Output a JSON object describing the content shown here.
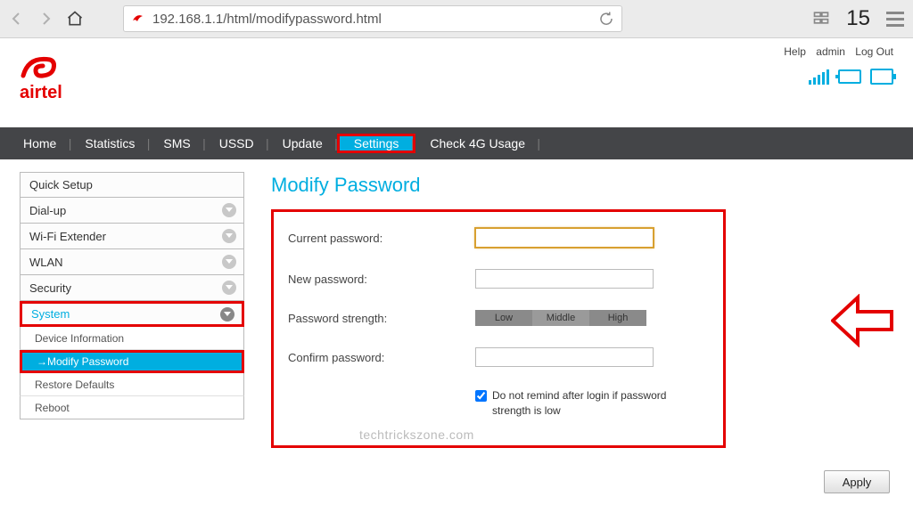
{
  "browser": {
    "url": "192.168.1.1/html/modifypassword.html",
    "tab_count": "15"
  },
  "brand": {
    "name": "airtel",
    "accent": "#e40000",
    "link_accent": "#00aee0"
  },
  "top_links": {
    "help": "Help",
    "admin": "admin",
    "logout": "Log Out"
  },
  "nav": {
    "items": [
      "Home",
      "Statistics",
      "SMS",
      "USSD",
      "Update",
      "Settings",
      "Check 4G Usage"
    ],
    "active_index": 5
  },
  "sidebar": {
    "items": [
      {
        "label": "Quick Setup",
        "arrow": false
      },
      {
        "label": "Dial-up",
        "arrow": true
      },
      {
        "label": "Wi-Fi Extender",
        "arrow": true
      },
      {
        "label": "WLAN",
        "arrow": true
      },
      {
        "label": "Security",
        "arrow": true
      },
      {
        "label": "System",
        "arrow": true
      }
    ],
    "sub_items": [
      "Device Information",
      "→Modify Password",
      "Restore Defaults",
      "Reboot"
    ],
    "active_sub_index": 1
  },
  "page": {
    "title": "Modify Password",
    "current_label": "Current password:",
    "new_label": "New password:",
    "strength_label": "Password strength:",
    "confirm_label": "Confirm password:",
    "strength_levels": [
      "Low",
      "Middle",
      "High"
    ],
    "checkbox_label": "Do not remind after login if password strength is low",
    "checkbox_checked": true,
    "current_value": "",
    "new_value": "",
    "confirm_value": "",
    "apply": "Apply",
    "watermark": "techtrickszone.com"
  }
}
